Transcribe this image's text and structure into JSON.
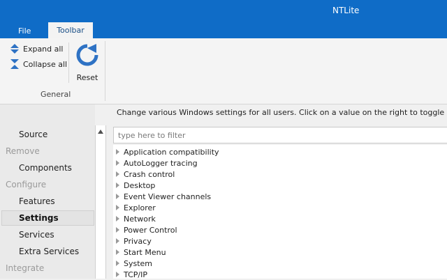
{
  "window": {
    "title": "NTLite"
  },
  "menu": {
    "file_label": "File",
    "toolbar_label": "Toolbar"
  },
  "ribbon": {
    "expand_all_label": "Expand all",
    "collapse_all_label": "Collapse all",
    "reset_label": "Reset",
    "group_label": "General"
  },
  "nav": {
    "source": "Source",
    "remove_heading": "Remove",
    "components": "Components",
    "configure_heading": "Configure",
    "features": "Features",
    "settings": "Settings",
    "services": "Services",
    "extra_services": "Extra Services",
    "integrate_heading": "Integrate"
  },
  "info_text": "Change various Windows settings for all users. Click on a value on the right to toggle choices",
  "filter": {
    "placeholder": "type here to filter"
  },
  "tree_items": [
    "Application compatibility",
    "AutoLogger tracing",
    "Crash control",
    "Desktop",
    "Event Viewer channels",
    "Explorer",
    "Network",
    "Power Control",
    "Privacy",
    "Start Menu",
    "System",
    "TCP/IP"
  ],
  "colors": {
    "accent": "#0f6cc7",
    "icon_blue": "#2e72c4"
  }
}
